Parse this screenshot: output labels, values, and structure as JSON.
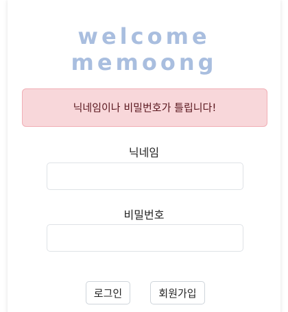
{
  "logo": {
    "line1": "welcome",
    "line2": "memoong"
  },
  "alert": {
    "message": "닉네임이나 비밀번호가 틀립니다!"
  },
  "form": {
    "nickname_label": "닉네임",
    "nickname_value": "",
    "password_label": "비밀번호",
    "password_value": ""
  },
  "buttons": {
    "login": "로그인",
    "signup": "회원가입"
  },
  "colors": {
    "logo": "#a9bedf",
    "alert_bg": "#f8d7da",
    "alert_border": "#f1aeb5",
    "alert_text": "#58151c"
  }
}
